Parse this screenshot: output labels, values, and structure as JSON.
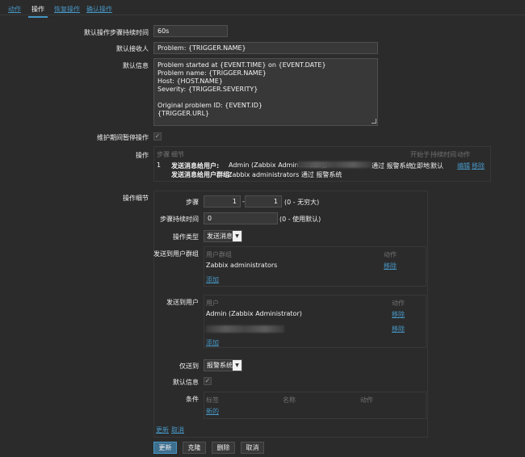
{
  "tabs": [
    {
      "label": "动作",
      "active": false
    },
    {
      "label": "操作",
      "active": true
    },
    {
      "label": "恢复操作",
      "active": false
    },
    {
      "label": "确认操作",
      "active": false
    }
  ],
  "form": {
    "step_duration_label": "默认操作步骤持续时间",
    "step_duration_value": "60s",
    "subject_label": "默认接收人",
    "subject_value": "Problem: {TRIGGER.NAME}",
    "message_label": "默认信息",
    "message_value": "Problem started at {EVENT.TIME} on {EVENT.DATE}\nProblem name: {TRIGGER.NAME}\nHost: {HOST.NAME}\nSeverity: {TRIGGER.SEVERITY}\n\nOriginal problem ID: {EVENT.ID}\n{TRIGGER.URL}",
    "pause_label": "维护期间暂停操作",
    "pause_checked": true
  },
  "operations": {
    "label": "操作",
    "headers": {
      "steps": "步骤",
      "details": "细节",
      "start_in": "开始于",
      "duration": "持续时间",
      "action": "动作"
    },
    "row": {
      "step": "1",
      "line1_prefix": "发送消息给用户:",
      "line1_text": "Admin (Zabbix Administrator),",
      "line1_suffix": "通过 报警系统",
      "start_in": "立即地",
      "duration": "默认",
      "edit": "编辑",
      "remove": "移除",
      "line2_prefix": "发送消息给用户群组:",
      "line2_text": "Zabbix administrators 通过 报警系统"
    }
  },
  "details": {
    "label": "操作细节",
    "steps_label": "步骤",
    "step_from": "1",
    "step_sep": "-",
    "step_to": "1",
    "step_hint": "(0 - 无穷大)",
    "duration_label": "步骤持续时间",
    "duration_value": "0",
    "duration_hint": "(0 - 使用默认)",
    "optype_label": "操作类型",
    "optype_value": "发送消息",
    "send_groups_label": "发送到用户群组",
    "groups_header_group": "用户群组",
    "groups_header_action": "动作",
    "group_item": "Zabbix administrators",
    "group_remove": "移除",
    "group_add": "添加",
    "send_users_label": "发送到用户",
    "users_header_user": "用户",
    "users_header_action": "动作",
    "user_item": "Admin (Zabbix Administrator)",
    "user_remove_1": "移除",
    "user_remove_2": "移除",
    "user_add": "添加",
    "send_only_label": "仅送到",
    "send_only_value": "报警系统",
    "default_msg_label": "默认信息",
    "default_msg_checked": true,
    "conditions_label": "条件",
    "cond_header_label": "标签",
    "cond_header_name": "名称",
    "cond_header_action": "动作",
    "cond_new": "新的",
    "update_link": "更新",
    "cancel_link": "取消"
  },
  "buttons": {
    "update": "更新",
    "clone": "克隆",
    "delete": "删除",
    "cancel": "取消"
  }
}
